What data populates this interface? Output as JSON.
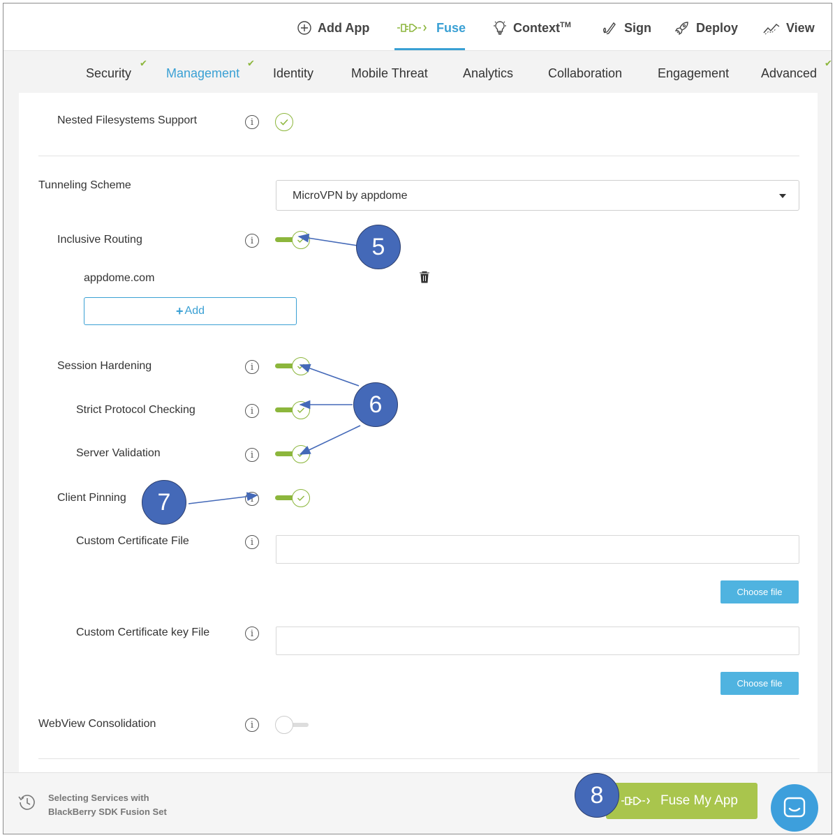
{
  "topnav": {
    "items": [
      {
        "label": "Add App",
        "icon": "plus-circle-icon"
      },
      {
        "label": "Fuse",
        "icon": "plug-icon"
      },
      {
        "label": "Context",
        "sup": "TM",
        "icon": "lightbulb-icon"
      },
      {
        "label": "Sign",
        "icon": "signature-icon"
      },
      {
        "label": "Deploy",
        "icon": "rocket-icon"
      },
      {
        "label": "View",
        "icon": "chart-icon"
      }
    ],
    "active": "Fuse",
    "accent": "#3aa0d4"
  },
  "subnav": {
    "tabs": [
      "Security",
      "Management",
      "Identity",
      "Mobile Threat",
      "Analytics",
      "Collaboration",
      "Engagement",
      "Advanced"
    ],
    "active": "Management",
    "tick": "✔",
    "tick_color": "#8cb63c"
  },
  "settings": {
    "nested_fs": "Nested Filesystems Support",
    "tunneling_scheme": "Tunneling Scheme",
    "tunneling_value": "MicroVPN by appdome",
    "inclusive_routing": "Inclusive Routing",
    "domain_entry": "appdome.com",
    "add_label": "Add",
    "session_hardening": "Session Hardening",
    "strict_protocol": "Strict Protocol Checking",
    "server_validation": "Server Validation",
    "client_pinning": "Client Pinning",
    "custom_cert_file": "Custom Certificate File",
    "custom_cert_key_file": "Custom Certificate key File",
    "choose_file": "Choose file",
    "webview_consolidation": "WebView Consolidation",
    "info_glyph": "i"
  },
  "footer": {
    "line1": "Selecting Services with",
    "line2": "BlackBerry SDK Fusion Set",
    "fuse_button": "Fuse My App"
  },
  "callouts": {
    "c5": "5",
    "c6": "6",
    "c7": "7",
    "c8": "8"
  },
  "colors": {
    "green": "#8cb63c",
    "blue": "#3aa0d4",
    "callout": "#4469b8"
  }
}
